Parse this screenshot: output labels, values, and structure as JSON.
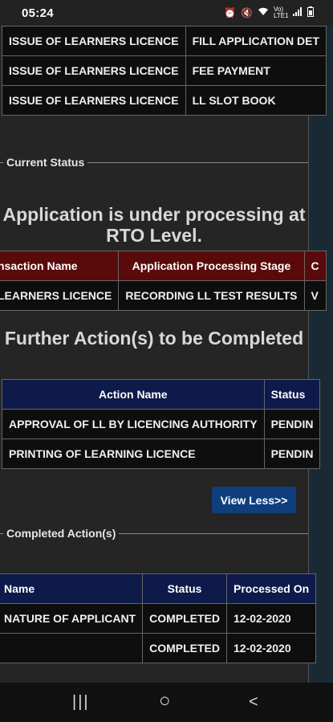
{
  "status_bar": {
    "time": "05:24",
    "icons": [
      "alarm-icon",
      "mute-icon",
      "wifi-icon",
      "volte-icon",
      "signal-icon",
      "battery-icon"
    ],
    "volte_text": "Vo) LTE1"
  },
  "top_table": {
    "rows": [
      [
        "ISSUE OF LEARNERS LICENCE",
        "FILL APPLICATION DET"
      ],
      [
        "ISSUE OF LEARNERS LICENCE",
        "FEE PAYMENT"
      ],
      [
        "ISSUE OF LEARNERS LICENCE",
        "LL SLOT BOOK"
      ]
    ]
  },
  "current_status": {
    "legend": "Current Status",
    "heading": "Application is under processing at RTO Level.",
    "table": {
      "headers": [
        "nsaction Name",
        "Application Processing Stage",
        "C"
      ],
      "rows": [
        [
          "LEARNERS LICENCE",
          "RECORDING LL TEST RESULTS",
          "V"
        ]
      ]
    },
    "further_heading": "Further Action(s) to be Completed",
    "further_table": {
      "headers": [
        "Action Name",
        "Status"
      ],
      "rows": [
        [
          "APPROVAL OF LL BY LICENCING AUTHORITY",
          "PENDIN"
        ],
        [
          "PRINTING OF LEARNING LICENCE",
          "PENDIN"
        ]
      ]
    },
    "view_less_label": "View Less>>"
  },
  "completed": {
    "legend": "Completed Action(s)",
    "table": {
      "headers": [
        "Name",
        "Status",
        "Processed On"
      ],
      "rows": [
        [
          "NATURE OF APPLICANT",
          "COMPLETED",
          "12-02-2020"
        ],
        [
          "",
          "COMPLETED",
          "12-02-2020"
        ]
      ]
    }
  },
  "nav_bar": {
    "recents_glyph": "|||",
    "home_glyph": "○",
    "back_glyph": "<"
  }
}
